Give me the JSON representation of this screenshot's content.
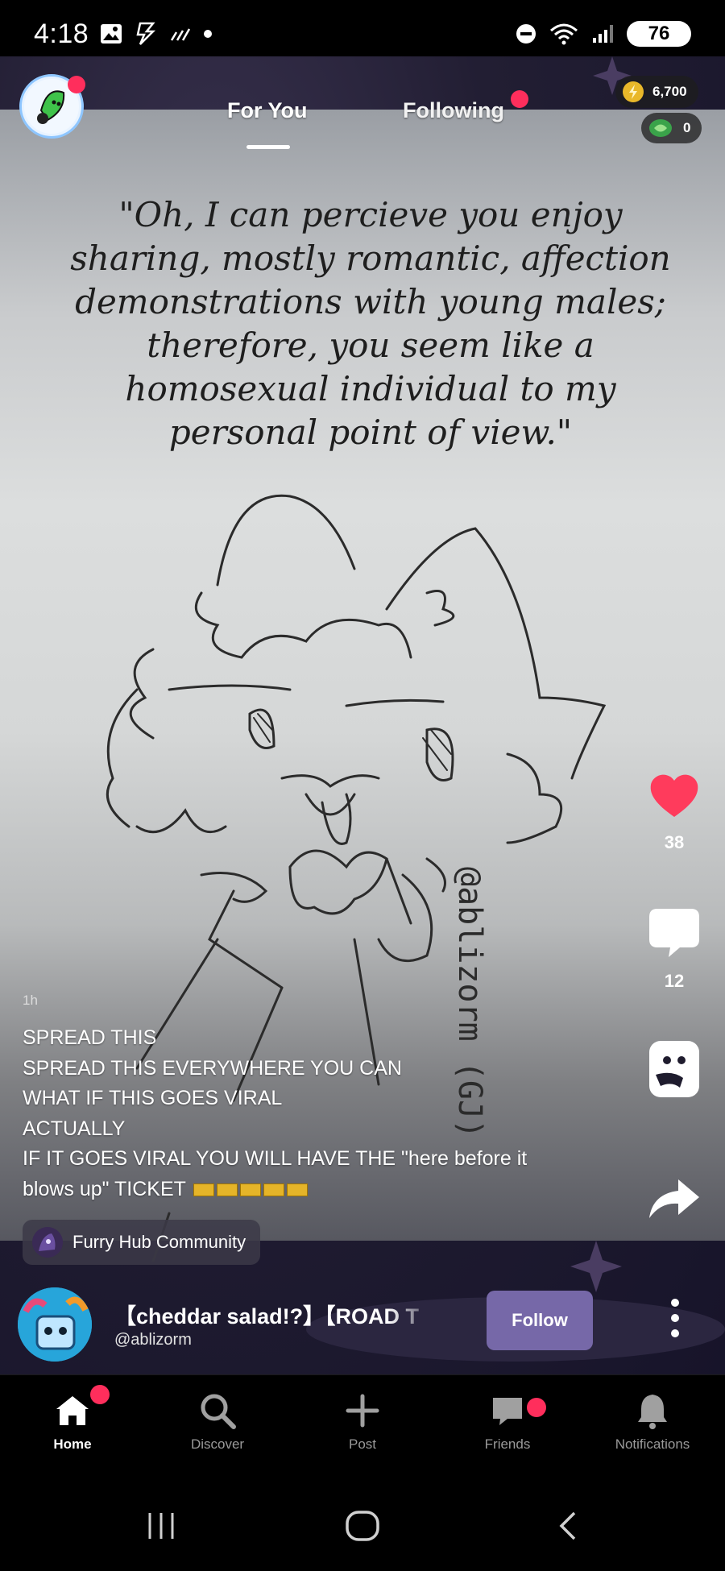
{
  "status_bar": {
    "time": "4:18",
    "battery": "76"
  },
  "header": {
    "tabs": [
      {
        "label": "For You",
        "active": true
      },
      {
        "label": "Following",
        "active": false
      }
    ],
    "coins": "6,700",
    "gems": "0"
  },
  "post": {
    "quote": "\"Oh, I can percieve you enjoy sharing, mostly romantic, affection demonstrations with young males; therefore, you seem like a homosexual individual to my personal point of view.\"",
    "watermark": "@ablizorm (GJ)",
    "timestamp": "1h",
    "caption_lines": [
      "SPREAD THIS",
      "SPREAD THIS EVERYWHERE YOU CAN",
      "WHAT IF THIS GOES VIRAL",
      "ACTUALLY",
      "IF IT GOES VIRAL YOU WILL HAVE THE \"here before it",
      "blows up\" TICKET"
    ],
    "community": "Furry Hub Community",
    "author_name": "【cheddar salad!?】【ROAD T",
    "author_handle": "@ablizorm",
    "follow_label": "Follow"
  },
  "actions": {
    "likes": "38",
    "comments": "12"
  },
  "bottom_nav": [
    {
      "label": "Home",
      "icon": "home-icon",
      "active": true
    },
    {
      "label": "Discover",
      "icon": "search-icon",
      "active": false
    },
    {
      "label": "Post",
      "icon": "plus-icon",
      "active": false
    },
    {
      "label": "Friends",
      "icon": "chat-icon",
      "active": false
    },
    {
      "label": "Notifications",
      "icon": "bell-icon",
      "active": false
    }
  ],
  "colors": {
    "accent_red": "#ff2e5c",
    "follow_button": "#7668a8",
    "like_heart": "#ff3b5c"
  }
}
